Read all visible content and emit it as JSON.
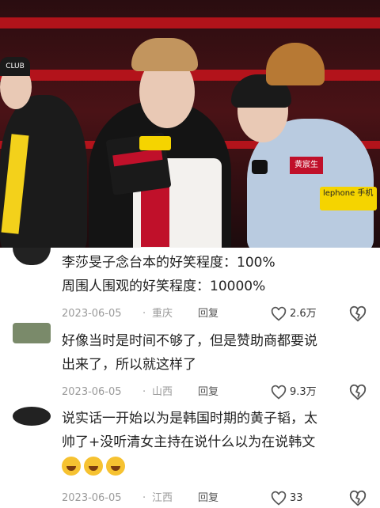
{
  "video": {
    "overlay_labels": [
      "CLUB",
      "黄宸生",
      "lephone 手机"
    ]
  },
  "comments": [
    {
      "lines": [
        "李莎旻子念台本的好笑程度：100%",
        "周围人围观的好笑程度：10000%"
      ],
      "date": "2023-06-05",
      "location": "重庆",
      "reply": "回复",
      "likes": "2.6万"
    },
    {
      "lines": [
        "好像当时是时间不够了，但是赞助商都要说",
        "出来了，所以就这样了"
      ],
      "date": "2023-06-05",
      "location": "山西",
      "reply": "回复",
      "likes": "9.3万"
    },
    {
      "lines": [
        "说实话一开始以为是韩国时期的黄子韬，太",
        "帅了+没听清女主持在说什么以为在说韩文"
      ],
      "date": "2023-06-05",
      "location": "江西",
      "reply": "回复",
      "likes": "33",
      "emojis": [
        "crying-laughing",
        "crying-laughing",
        "crying-laughing"
      ]
    }
  ],
  "colors": {
    "heart_stroke": "#555555",
    "meta_gray": "#9a9a9a"
  }
}
